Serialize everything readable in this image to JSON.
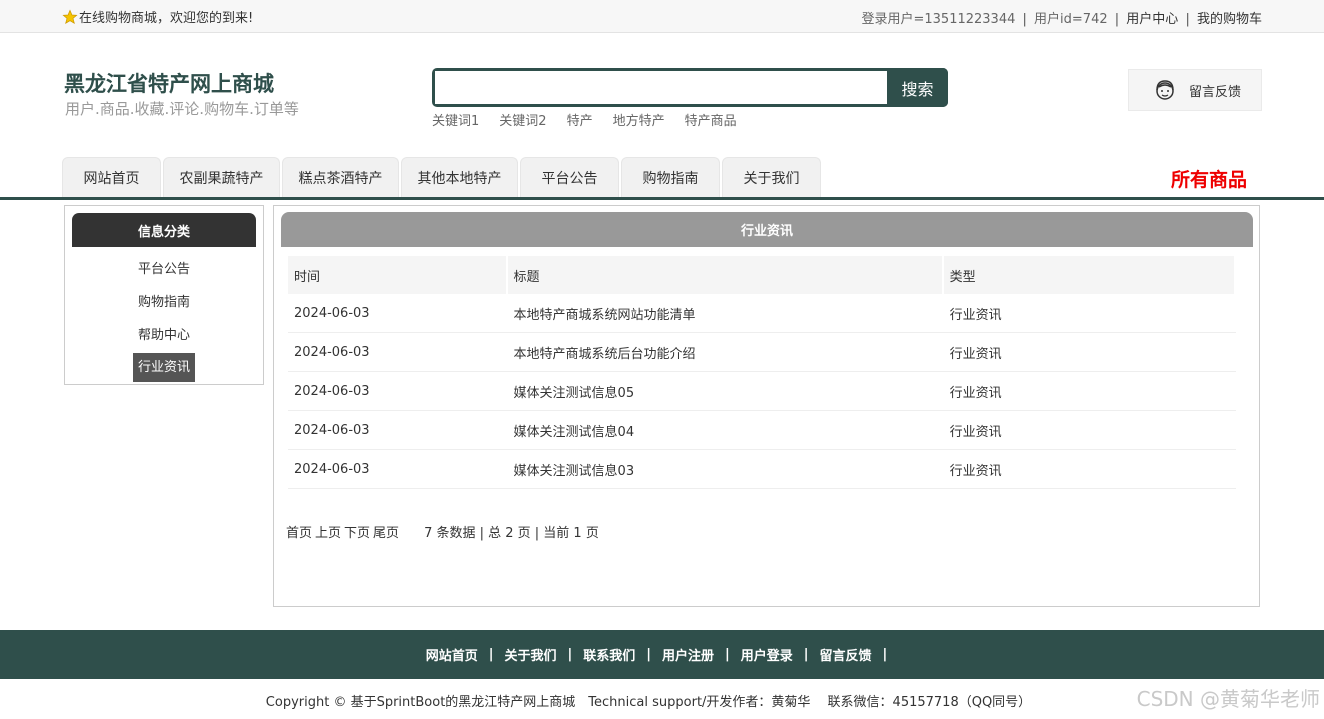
{
  "topbar": {
    "welcome": "在线购物商城，欢迎您的到来!",
    "login_user": "登录用户=13511223344",
    "user_id": "用户id=742",
    "user_center": "用户中心",
    "cart": "我的购物车",
    "sep": "|"
  },
  "header": {
    "site_title": "黑龙江省特产网上商城",
    "site_subtitle": "用户.商品.收藏.评论.购物车.订单等",
    "search_placeholder": "",
    "search_button": "搜索",
    "keywords": [
      "关键词1",
      "关键词2",
      "特产",
      "地方特产",
      "特产商品"
    ],
    "feedback": "留言反馈"
  },
  "nav": {
    "tabs": [
      "网站首页",
      "农副果蔬特产",
      "糕点茶酒特产",
      "其他本地特产",
      "平台公告",
      "购物指南",
      "关于我们"
    ],
    "all_goods": "所有商品"
  },
  "sidebar": {
    "title": "信息分类",
    "items": [
      "平台公告",
      "购物指南",
      "帮助中心",
      "行业资讯"
    ],
    "active": "行业资讯"
  },
  "main": {
    "title": "行业资讯",
    "columns": [
      "时间",
      "标题",
      "类型"
    ],
    "rows": [
      [
        "2024-06-03",
        "本地特产商城系统网站功能清单",
        "行业资讯"
      ],
      [
        "2024-06-03",
        "本地特产商城系统后台功能介绍",
        "行业资讯"
      ],
      [
        "2024-06-03",
        "媒体关注测试信息05",
        "行业资讯"
      ],
      [
        "2024-06-03",
        "媒体关注测试信息04",
        "行业资讯"
      ],
      [
        "2024-06-03",
        "媒体关注测试信息03",
        "行业资讯"
      ]
    ],
    "pager": {
      "first": "首页",
      "prev": "上页",
      "next": "下页",
      "last": "尾页",
      "info": "7 条数据 | 总 2 页 | 当前 1 页"
    }
  },
  "footer": {
    "links": [
      "网站首页",
      "关于我们",
      "联系我们",
      "用户注册",
      "用户登录",
      "留言反馈"
    ],
    "sep": "|",
    "copyright": "Copyright © 基于SprintBoot的黑龙江特产网上商城　Technical support/开发作者：黄菊华　 联系微信：45157718（QQ同号）"
  },
  "watermark": "CSDN @黄菊华老师",
  "colors": {
    "brand": "#2f4f4b",
    "accent_red": "#ee0000",
    "sidebar_head": "#333333",
    "main_head": "#999999"
  }
}
